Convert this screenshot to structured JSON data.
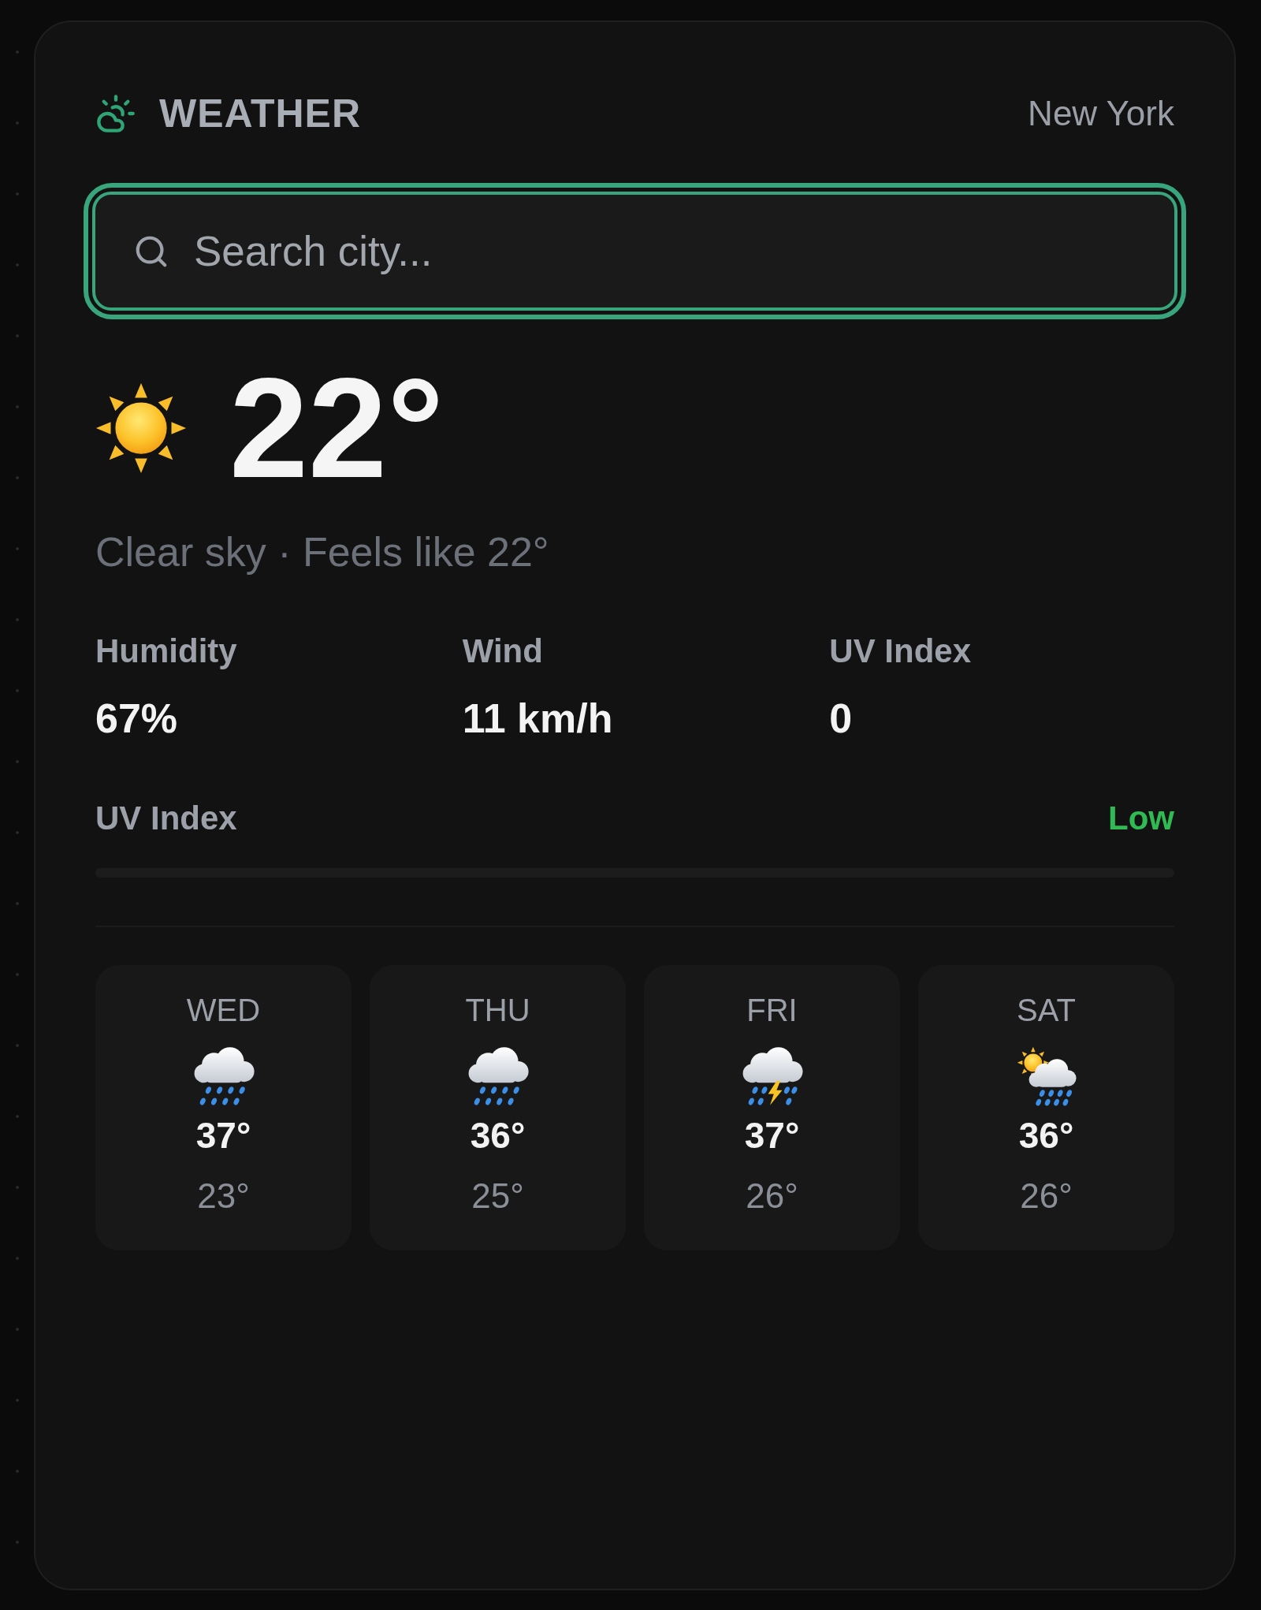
{
  "header": {
    "title": "WEATHER",
    "location": "New York"
  },
  "search": {
    "placeholder": "Search city...",
    "focused": true
  },
  "current": {
    "kind": "clear",
    "temperature": "22°",
    "summary": "Clear sky · Feels like 22°"
  },
  "stats": [
    {
      "label": "Humidity",
      "value": "67%"
    },
    {
      "label": "Wind",
      "value": "11 km/h"
    },
    {
      "label": "UV Index",
      "value": "0"
    }
  ],
  "uv_meter": {
    "label": "UV Index",
    "rating": "Low",
    "level": 0
  },
  "forecast": [
    {
      "day": "WED",
      "kind": "rain",
      "high": "37°",
      "low": "23°"
    },
    {
      "day": "THU",
      "kind": "rain",
      "high": "36°",
      "low": "25°"
    },
    {
      "day": "FRI",
      "kind": "storm",
      "high": "37°",
      "low": "26°"
    },
    {
      "day": "SAT",
      "kind": "sun_rain",
      "high": "36°",
      "low": "26°"
    }
  ]
}
